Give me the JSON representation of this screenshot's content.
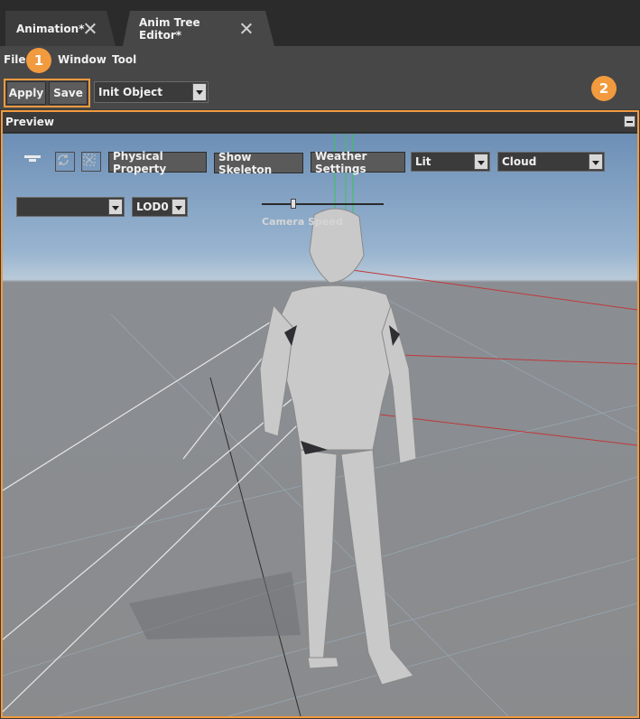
{
  "tabs": [
    {
      "label": "Animation*"
    },
    {
      "label": "Anim Tree Editor*"
    }
  ],
  "menu": {
    "file": "File",
    "window": "Window",
    "tool": "Tool"
  },
  "toolbar": {
    "apply_label": "Apply",
    "save_label": "Save",
    "init_select": "Init Object"
  },
  "badges": {
    "one": "1",
    "two": "2"
  },
  "preview": {
    "title": "Preview",
    "physical_property": "Physical Property",
    "show_skeleton": "Show Skeleton",
    "weather_settings": "Weather Settings",
    "lighting_select": "Lit",
    "sky_select": "Cloud",
    "mesh_select": "",
    "lod_select": "LOD0",
    "camera_speed_label": "Camera Speed",
    "camera_speed_value": 0.25
  },
  "colors": {
    "accent": "#f29a3e",
    "panel": "#474747",
    "tabbar": "#2b2b2b"
  },
  "icons": [
    "close-icon",
    "camera-view-icon",
    "refresh-icon",
    "fit-view-icon",
    "dropdown-arrow-icon",
    "pin-icon"
  ]
}
